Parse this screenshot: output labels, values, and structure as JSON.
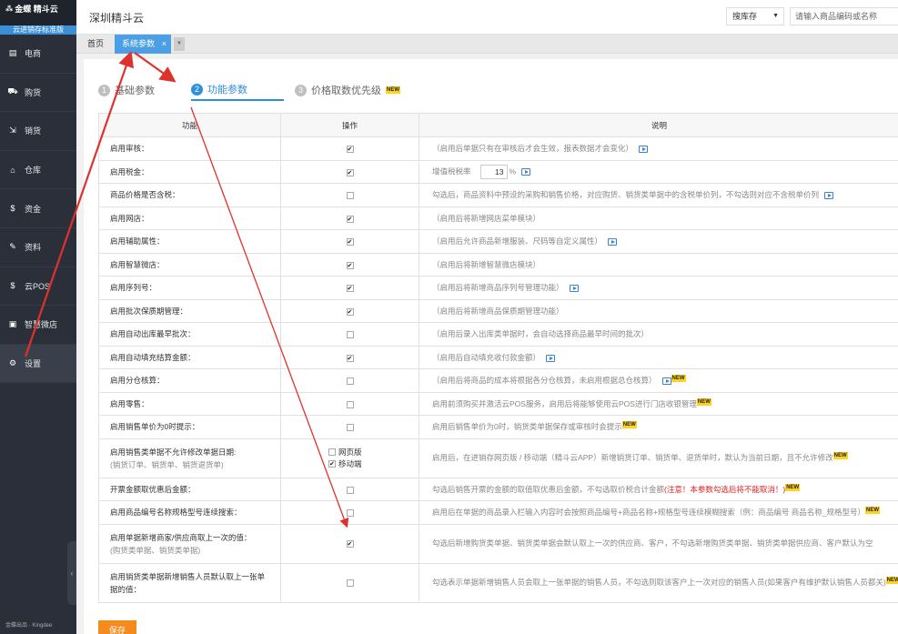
{
  "sidebar": {
    "logo_brand": "金蝶 精斗云",
    "edition": "云进销存标准版",
    "items": [
      {
        "label": "电商",
        "icon": "store-icon"
      },
      {
        "label": "购货",
        "icon": "cart-icon"
      },
      {
        "label": "销货",
        "icon": "sales-icon"
      },
      {
        "label": "仓库",
        "icon": "warehouse-icon"
      },
      {
        "label": "资金",
        "icon": "money-icon"
      },
      {
        "label": "资料",
        "icon": "pen-icon"
      },
      {
        "label": "云POS",
        "icon": "pos-icon"
      },
      {
        "label": "智慧微店",
        "icon": "shop-icon"
      },
      {
        "label": "设置",
        "icon": "gear-icon"
      }
    ],
    "footer": "金蝶出品 · Kingdee"
  },
  "header": {
    "company": "深圳精斗云",
    "search_type": "搜库存",
    "search_placeholder": "请输入商品编码或名称"
  },
  "tabs": {
    "home": "首页",
    "active": "系统参数",
    "close": "×"
  },
  "steps": [
    {
      "num": "1",
      "label": "基础参数"
    },
    {
      "num": "2",
      "label": "功能参数"
    },
    {
      "num": "3",
      "label": "价格取数优先级",
      "badge": "NEW"
    }
  ],
  "table": {
    "headers": [
      "功能",
      "操作",
      "说明"
    ],
    "rows": [
      {
        "func": "启用审核：",
        "checked": true,
        "desc": "（启用后单据只有在审核后才会生效，报表数据才会变化）",
        "video": true
      },
      {
        "func": "启用税金：",
        "checked": true,
        "desc_prefix": "增值税税率",
        "tax_value": "13",
        "tax_unit": "%",
        "video": true,
        "type": "tax"
      },
      {
        "func": "商品价格是否含税：",
        "checked": false,
        "desc": "勾选后，商品资料中预设的采购和销售价格，对应购货、销货类单据中的含税单价列，不勾选则对应不含税单价列",
        "video": true
      },
      {
        "func": "启用网店：",
        "checked": true,
        "desc": "（启用后将新增网店菜单模块）"
      },
      {
        "func": "启用辅助属性：",
        "checked": true,
        "desc": "（启用后允许商品新增服装、尺码等自定义属性）",
        "video": true
      },
      {
        "func": "启用智慧微店：",
        "checked": true,
        "desc": "（启用后将新增智慧微店模块）"
      },
      {
        "func": "启用序列号：",
        "checked": true,
        "desc": "（启用后将新增商品序列号管理功能）",
        "video": true
      },
      {
        "func": "启用批次保质期管理：",
        "checked": true,
        "desc": "（启用后将新增商品保质期管理功能）"
      },
      {
        "func": "启用自动出库最早批次：",
        "checked": false,
        "desc": "（启用后录入出库类单据时，会自动选择商品最早时间的批次）"
      },
      {
        "func": "启用自动填充结算金额：",
        "checked": true,
        "desc": "（启用后自动填充收付款金额）",
        "video": true
      },
      {
        "func": "启用分仓核算：",
        "checked": false,
        "desc": "（启用后将商品的成本将根据各分仓核算，未启用根据总仓核算）",
        "video": true,
        "badge": "NEW"
      },
      {
        "func": "启用零售：",
        "checked": false,
        "desc": "启用前须购买并激活云POS服务，启用后将能够使用云POS进行门店收银管理",
        "badge": "NEW"
      },
      {
        "func": "启用销售单价为0时提示：",
        "checked": false,
        "desc": "启用后销售单价为0时，销货类单据保存或审核时会提示",
        "badge": "NEW"
      },
      {
        "func": "启用销售类单据不允许修改单据日期:",
        "func_sub": "(销货订单、销货单、销货退货单)",
        "type": "multi",
        "options": [
          {
            "label": "网页版",
            "checked": false
          },
          {
            "label": "移动端",
            "checked": true
          }
        ],
        "desc": "启用后，在进销存网页版 / 移动端（精斗云APP）新增销货订单、销货单、退货单时，默认为当前日期，且不允许修改",
        "badge": "NEW"
      },
      {
        "func": "开票金额取优惠后金额：",
        "checked": false,
        "desc": "勾选后销售开票的金额的取值取优惠后金额，不勾选取价税合计金额",
        "warn": "(注意！本参数勾选后将不能取消！)",
        "badge": "NEW"
      },
      {
        "func": "启用商品编号名称规格型号连续搜索：",
        "checked": false,
        "desc": "启用后在单据的商品录入栏输入内容时会按照商品编号+商品名称+规格型号连续模糊搜索（例：商品编号 商品名称_规格型号）",
        "badge": "NEW"
      },
      {
        "func": "启用单据新增商家/供应商取上一次的值：",
        "func_sub": "(购货类单据、销货类单据)",
        "checked": true,
        "desc": "勾选后新增购货类单据、销货类单据会默认取上一次的供应商、客户，不勾选新增购货类单据、销货类单据供应商、客户默认为空",
        "type": "tall"
      },
      {
        "func": "启用销货类单据新增销售人员默认取上一张单据的值：",
        "checked": false,
        "desc": "勾选表示单据新增销售人员会取上一张单据的销售人员，不勾选则取该客户上一次对应的销售人员(如果客户有维护默认销售人员都关)",
        "badge": "NEW",
        "type": "tall"
      }
    ]
  },
  "save_label": "保存"
}
